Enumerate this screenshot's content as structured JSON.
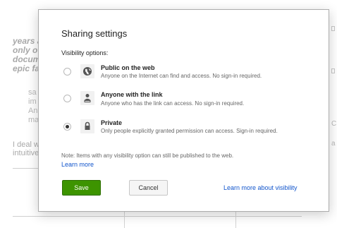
{
  "background": {
    "italic_lines": [
      "years a",
      "only o",
      "docum",
      "epic fa"
    ],
    "small_lines": [
      "sa",
      "im",
      "An",
      "ma"
    ],
    "normal_lines": [
      "I deal w",
      "intuitive"
    ],
    "right_fragments": [
      "C",
      "a"
    ]
  },
  "dialog": {
    "title": "Sharing settings",
    "visibility_label": "Visibility options:",
    "options": [
      {
        "title": "Public on the web",
        "description": "Anyone on the Internet can find and access. No sign-in required.",
        "icon": "globe-icon",
        "selected": false
      },
      {
        "title": "Anyone with the link",
        "description": "Anyone who has the link can access. No sign-in required.",
        "icon": "link-user-icon",
        "selected": false
      },
      {
        "title": "Private",
        "description": "Only people explicitly granted permission can access. Sign-in required.",
        "icon": "lock-icon",
        "selected": true
      }
    ],
    "note": "Note: Items with any visibility option can still be published to the web.",
    "learn_more": "Learn more",
    "save_label": "Save",
    "cancel_label": "Cancel",
    "learn_more_visibility": "Learn more about visibility"
  },
  "colors": {
    "save_button": "#3d9400",
    "link": "#1155cc"
  }
}
